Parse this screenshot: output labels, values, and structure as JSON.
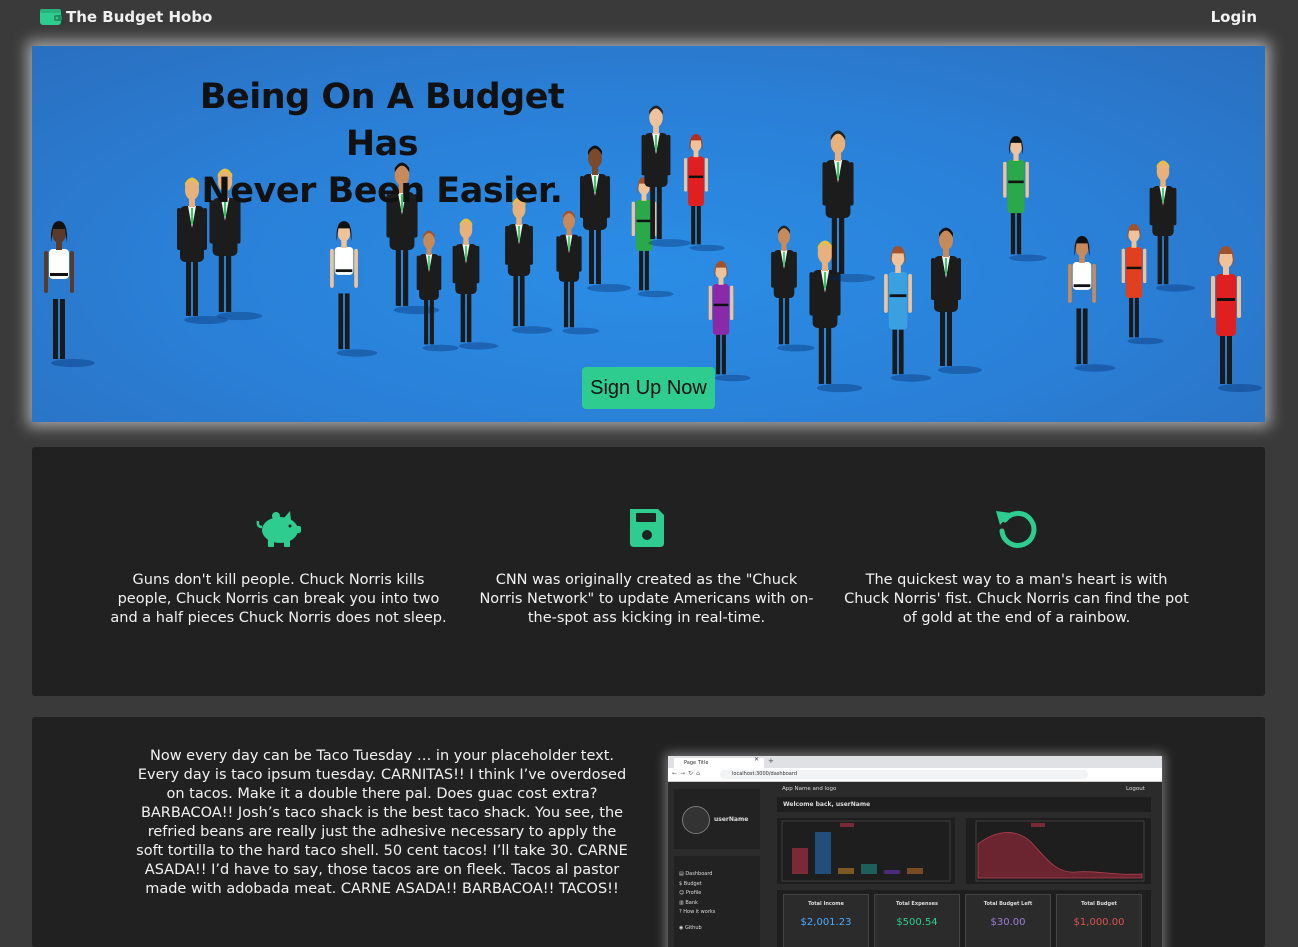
{
  "colors": {
    "accent": "#2ecc8f",
    "background": "#3a3a3a",
    "panel": "#212121",
    "hero": "#2a7fd6"
  },
  "navbar": {
    "brand": "The Budget Hobo",
    "brand_icon": "wallet-icon",
    "login": "Login"
  },
  "hero": {
    "title_line1": "Being On A Budget Has",
    "title_line2": "Never Been Easier.",
    "signup": "Sign Up Now"
  },
  "features": [
    {
      "icon": "piggy-bank-icon",
      "text": "Guns don't kill people. Chuck Norris kills people, Chuck Norris can break you into two and a half pieces Chuck Norris does not sleep."
    },
    {
      "icon": "save-icon",
      "text": "CNN was originally created as the \"Chuck Norris Network\" to update Americans with on-the-spot ass kicking in real-time."
    },
    {
      "icon": "undo-icon",
      "text": "The quickest way to a man's heart is with Chuck Norris' fist. Chuck Norris can find the pot of gold at the end of a rainbow."
    }
  ],
  "about": {
    "text": "Now every day can be Taco Tuesday … in your placeholder text. Every day is taco ipsum tuesday. CARNITAS!! I think I’ve overdosed on tacos. Make it a double there pal. Does guac cost extra? BARBACOA!! Josh’s taco shack is the best taco shack. You see, the refried beans are really just the adhesive necessary to apply the soft tortilla to the hard taco shell. 50 cent tacos! I’ll take 30. CARNE ASADA!! I’d have to say, those tacos are on fleek. Tacos al pastor made with adobada meat. CARNE ASADA!! BARBACOA!! TACOS!!"
  },
  "screenshot": {
    "tab_title": "Page Title",
    "url": "localhost:3000/dashboard",
    "app_name": "App Name and logo",
    "logout": "Logout",
    "welcome": "Welcome back, userName",
    "username": "userName",
    "nav": [
      "Dashboard",
      "Budget",
      "Profile",
      "Bank",
      "How it works",
      "Github"
    ],
    "stats": [
      {
        "label": "Total Income",
        "value": "$2,001.23",
        "color": "#4aa8ff"
      },
      {
        "label": "Total Expenses",
        "value": "$500.54",
        "color": "#2ecc8f"
      },
      {
        "label": "Total Budget Left",
        "value": "$30.00",
        "color": "#9b7fd6"
      },
      {
        "label": "Total Budget",
        "value": "$1,000.00",
        "color": "#d9534f"
      }
    ]
  }
}
